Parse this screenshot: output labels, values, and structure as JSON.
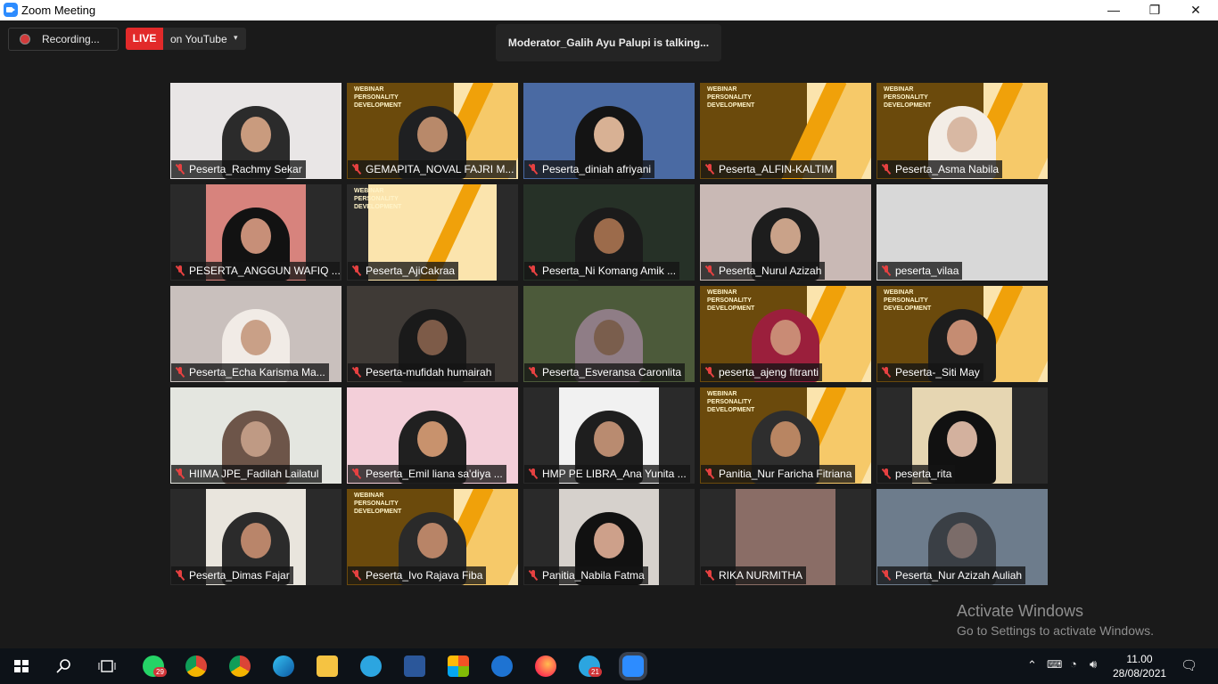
{
  "window": {
    "title": "Zoom Meeting",
    "min": "—",
    "max": "❐",
    "close": "✕"
  },
  "controls": {
    "recording_label": "Recording...",
    "live_label": "LIVE",
    "live_destination": "on YouTube",
    "caret": "▾"
  },
  "talking": "Moderator_Galih Ayu Palupi is talking...",
  "participants": [
    "Peserta_Rachmy Sekar",
    "GEMAPITA_NOVAL FAJRI M...",
    "Peserta_diniah afriyani",
    "Peserta_ALFIN-KALTIM",
    "Peserta_Asma Nabila",
    "PESERTA_ANGGUN WAFIQ ...",
    "Peserta_AjiCakraa",
    "Peserta_Ni Komang Amik ...",
    "Peserta_Nurul Azizah",
    "peserta_vilaa",
    "Peserta_Echa Karisma  Ma...",
    "Peserta-mufidah humairah",
    "Peserta_Esveransa Caronlita",
    "peserta_ajeng fitranti",
    "Peserta-_Siti May",
    "HIIMA JPE_Fadilah Lailatul",
    "Peserta_Emil liana sa'diya ...",
    "HMP PE LIBRA_Ana Yunita ...",
    "Panitia_Nur Faricha Fitriana",
    "peserta_rita",
    "Peserta_Dimas Fajar",
    "Peserta_Ivo Rajava Fiba",
    "Panitia_Nabila Fatma",
    "RIKA NURMITHA",
    "Peserta_Nur Azizah Auliah"
  ],
  "banner_text": "WEBINAR\nPERSONALITY\nDEVELOPMENT",
  "watermark": {
    "line1": "Activate Windows",
    "line2": "Go to Settings to activate Windows."
  },
  "taskbar": {
    "whatsapp_badge": "29",
    "telegram_badge": "21",
    "time": "11.00",
    "date": "28/08/2021"
  },
  "colors": {
    "live_red": "#e22a2a",
    "accent_orange": "#f0a10a",
    "zoom_blue": "#2d8cff"
  }
}
